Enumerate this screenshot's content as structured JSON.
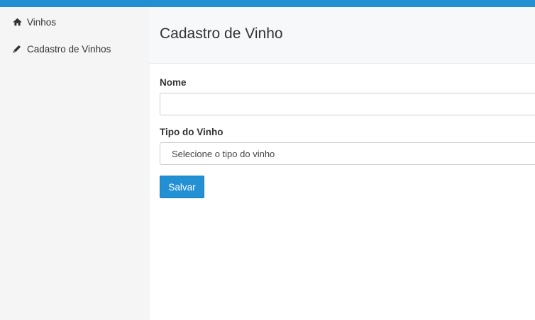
{
  "sidebar": {
    "items": [
      {
        "label": "Vinhos",
        "icon": "home-icon"
      },
      {
        "label": "Cadastro de Vinhos",
        "icon": "pencil-icon"
      }
    ]
  },
  "header": {
    "title": "Cadastro de Vinho"
  },
  "form": {
    "name_label": "Nome",
    "name_value": "",
    "type_label": "Tipo do Vinho",
    "type_selected": "Selecione o tipo do vinho",
    "save_label": "Salvar"
  },
  "colors": {
    "accent": "#2290d3",
    "sidebar_bg": "#f5f5f5",
    "header_bg": "#f7f8f9"
  }
}
